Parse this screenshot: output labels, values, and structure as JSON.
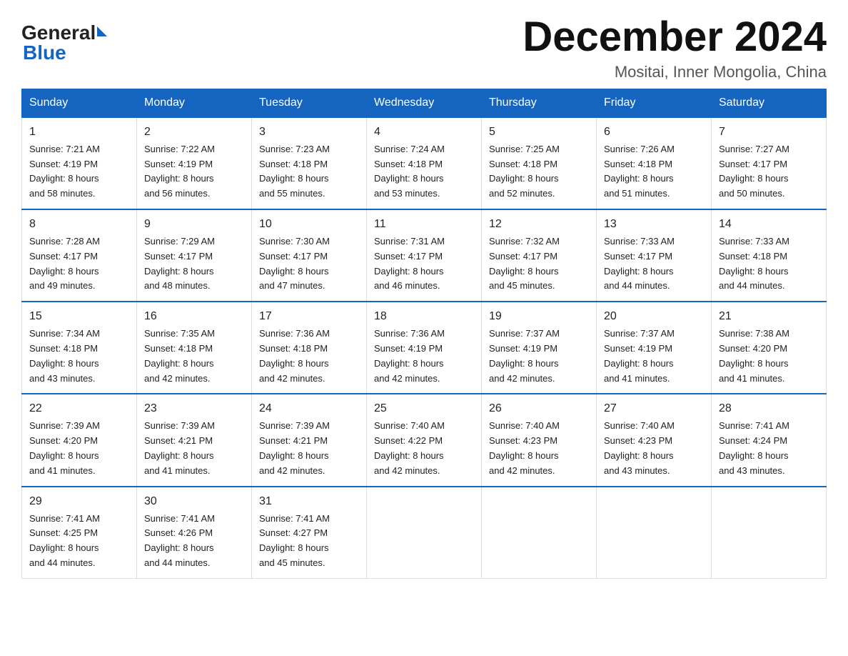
{
  "header": {
    "logo_general": "General",
    "logo_blue": "Blue",
    "month_title": "December 2024",
    "location": "Mositai, Inner Mongolia, China"
  },
  "days_of_week": [
    "Sunday",
    "Monday",
    "Tuesday",
    "Wednesday",
    "Thursday",
    "Friday",
    "Saturday"
  ],
  "weeks": [
    [
      {
        "date": "1",
        "sunrise": "7:21 AM",
        "sunset": "4:19 PM",
        "daylight": "8 hours and 58 minutes."
      },
      {
        "date": "2",
        "sunrise": "7:22 AM",
        "sunset": "4:19 PM",
        "daylight": "8 hours and 56 minutes."
      },
      {
        "date": "3",
        "sunrise": "7:23 AM",
        "sunset": "4:18 PM",
        "daylight": "8 hours and 55 minutes."
      },
      {
        "date": "4",
        "sunrise": "7:24 AM",
        "sunset": "4:18 PM",
        "daylight": "8 hours and 53 minutes."
      },
      {
        "date": "5",
        "sunrise": "7:25 AM",
        "sunset": "4:18 PM",
        "daylight": "8 hours and 52 minutes."
      },
      {
        "date": "6",
        "sunrise": "7:26 AM",
        "sunset": "4:18 PM",
        "daylight": "8 hours and 51 minutes."
      },
      {
        "date": "7",
        "sunrise": "7:27 AM",
        "sunset": "4:17 PM",
        "daylight": "8 hours and 50 minutes."
      }
    ],
    [
      {
        "date": "8",
        "sunrise": "7:28 AM",
        "sunset": "4:17 PM",
        "daylight": "8 hours and 49 minutes."
      },
      {
        "date": "9",
        "sunrise": "7:29 AM",
        "sunset": "4:17 PM",
        "daylight": "8 hours and 48 minutes."
      },
      {
        "date": "10",
        "sunrise": "7:30 AM",
        "sunset": "4:17 PM",
        "daylight": "8 hours and 47 minutes."
      },
      {
        "date": "11",
        "sunrise": "7:31 AM",
        "sunset": "4:17 PM",
        "daylight": "8 hours and 46 minutes."
      },
      {
        "date": "12",
        "sunrise": "7:32 AM",
        "sunset": "4:17 PM",
        "daylight": "8 hours and 45 minutes."
      },
      {
        "date": "13",
        "sunrise": "7:33 AM",
        "sunset": "4:17 PM",
        "daylight": "8 hours and 44 minutes."
      },
      {
        "date": "14",
        "sunrise": "7:33 AM",
        "sunset": "4:18 PM",
        "daylight": "8 hours and 44 minutes."
      }
    ],
    [
      {
        "date": "15",
        "sunrise": "7:34 AM",
        "sunset": "4:18 PM",
        "daylight": "8 hours and 43 minutes."
      },
      {
        "date": "16",
        "sunrise": "7:35 AM",
        "sunset": "4:18 PM",
        "daylight": "8 hours and 42 minutes."
      },
      {
        "date": "17",
        "sunrise": "7:36 AM",
        "sunset": "4:18 PM",
        "daylight": "8 hours and 42 minutes."
      },
      {
        "date": "18",
        "sunrise": "7:36 AM",
        "sunset": "4:19 PM",
        "daylight": "8 hours and 42 minutes."
      },
      {
        "date": "19",
        "sunrise": "7:37 AM",
        "sunset": "4:19 PM",
        "daylight": "8 hours and 42 minutes."
      },
      {
        "date": "20",
        "sunrise": "7:37 AM",
        "sunset": "4:19 PM",
        "daylight": "8 hours and 41 minutes."
      },
      {
        "date": "21",
        "sunrise": "7:38 AM",
        "sunset": "4:20 PM",
        "daylight": "8 hours and 41 minutes."
      }
    ],
    [
      {
        "date": "22",
        "sunrise": "7:39 AM",
        "sunset": "4:20 PM",
        "daylight": "8 hours and 41 minutes."
      },
      {
        "date": "23",
        "sunrise": "7:39 AM",
        "sunset": "4:21 PM",
        "daylight": "8 hours and 41 minutes."
      },
      {
        "date": "24",
        "sunrise": "7:39 AM",
        "sunset": "4:21 PM",
        "daylight": "8 hours and 42 minutes."
      },
      {
        "date": "25",
        "sunrise": "7:40 AM",
        "sunset": "4:22 PM",
        "daylight": "8 hours and 42 minutes."
      },
      {
        "date": "26",
        "sunrise": "7:40 AM",
        "sunset": "4:23 PM",
        "daylight": "8 hours and 42 minutes."
      },
      {
        "date": "27",
        "sunrise": "7:40 AM",
        "sunset": "4:23 PM",
        "daylight": "8 hours and 43 minutes."
      },
      {
        "date": "28",
        "sunrise": "7:41 AM",
        "sunset": "4:24 PM",
        "daylight": "8 hours and 43 minutes."
      }
    ],
    [
      {
        "date": "29",
        "sunrise": "7:41 AM",
        "sunset": "4:25 PM",
        "daylight": "8 hours and 44 minutes."
      },
      {
        "date": "30",
        "sunrise": "7:41 AM",
        "sunset": "4:26 PM",
        "daylight": "8 hours and 44 minutes."
      },
      {
        "date": "31",
        "sunrise": "7:41 AM",
        "sunset": "4:27 PM",
        "daylight": "8 hours and 45 minutes."
      },
      null,
      null,
      null,
      null
    ]
  ],
  "labels": {
    "sunrise_prefix": "Sunrise: ",
    "sunset_prefix": "Sunset: ",
    "daylight_prefix": "Daylight: "
  }
}
